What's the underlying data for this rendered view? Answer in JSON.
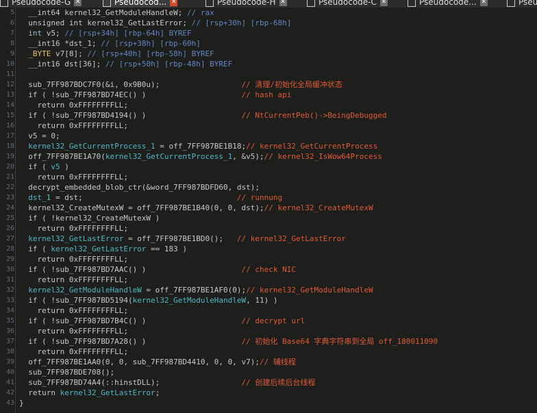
{
  "tabs": [
    {
      "label": "Pseudocode-G",
      "active": false
    },
    {
      "label": "Pseudocod...",
      "active": true
    },
    {
      "label": "Pseudocode-H",
      "active": false
    },
    {
      "label": "Pseudocode-C",
      "active": false
    },
    {
      "label": "Pseudocode...",
      "active": false
    },
    {
      "label": "Pseu",
      "active": false
    }
  ],
  "code": {
    "lines": [
      {
        "n": "5",
        "segs": [
          [
            "def",
            "  __int64 kernel32_GetModuleHandleW; "
          ],
          [
            "cm",
            "// rax"
          ]
        ]
      },
      {
        "n": "6",
        "segs": [
          [
            "def",
            "  unsigned int kernel32_GetLastError; "
          ],
          [
            "cm",
            "// [rsp+30h] [rbp-68h]"
          ]
        ]
      },
      {
        "n": "7",
        "segs": [
          [
            "type",
            "  int"
          ],
          [
            "def",
            " v5; "
          ],
          [
            "cm",
            "// [rsp+34h] [rbp-64h] BYREF"
          ]
        ]
      },
      {
        "n": "8",
        "segs": [
          [
            "def",
            "  __int16 *dst_1; "
          ],
          [
            "cm",
            "// [rsp+38h] [rbp-60h]"
          ]
        ]
      },
      {
        "n": "9",
        "segs": [
          [
            "var",
            "  _BYTE"
          ],
          [
            "def",
            " v7[8]; "
          ],
          [
            "cm",
            "// [rsp+40h] [rbp-58h] BYREF"
          ]
        ]
      },
      {
        "n": "10",
        "segs": [
          [
            "def",
            "  __int16 dst[36]; "
          ],
          [
            "cm",
            "// [rsp+50h] [rbp-48h] BYREF"
          ]
        ]
      },
      {
        "n": "11",
        "segs": [
          [
            "def",
            ""
          ]
        ]
      },
      {
        "n": "12",
        "segs": [
          [
            "def",
            "  sub_7FF987BDC7F0(&i, 0x9B0u);                  "
          ],
          [
            "cmz",
            "// 清理/初始化全局缓冲状态"
          ]
        ]
      },
      {
        "n": "13",
        "segs": [
          [
            "def",
            "  if ( !sub_7FF987BD74EC() )                     "
          ],
          [
            "cmz",
            "// hash api"
          ]
        ]
      },
      {
        "n": "14",
        "segs": [
          [
            "def",
            "    return 0xFFFFFFFFLL;"
          ]
        ]
      },
      {
        "n": "15",
        "segs": [
          [
            "def",
            "  if ( !sub_7FF987BD4194() )                     "
          ],
          [
            "cmz",
            "// NtCurrentPeb()->BeingDebugged"
          ]
        ]
      },
      {
        "n": "16",
        "segs": [
          [
            "def",
            "    return 0xFFFFFFFFLL;"
          ]
        ]
      },
      {
        "n": "17",
        "segs": [
          [
            "def",
            "  v5 = 0;"
          ]
        ]
      },
      {
        "n": "18",
        "segs": [
          [
            "gl",
            "  kernel32_GetCurrentProcess_1"
          ],
          [
            "def",
            " = off_7FF987BE1B18;"
          ],
          [
            "cmz",
            "// kernel32_GetCurrentProcess"
          ]
        ]
      },
      {
        "n": "19",
        "segs": [
          [
            "def",
            "  off_7FF987BE1A70("
          ],
          [
            "gl",
            "kernel32_GetCurrentProcess_1"
          ],
          [
            "def",
            ", &v5);"
          ],
          [
            "cmz",
            "// kernel32_IsWow64Process"
          ]
        ]
      },
      {
        "n": "20",
        "segs": [
          [
            "def",
            "  if ( "
          ],
          [
            "gl",
            "v5"
          ],
          [
            "def",
            " )"
          ]
        ]
      },
      {
        "n": "21",
        "segs": [
          [
            "def",
            "    return 0xFFFFFFFFLL;"
          ]
        ]
      },
      {
        "n": "22",
        "segs": [
          [
            "def",
            "  decrypt_embedded_blob_ctr(&word_7FF987BDFD60, "
          ],
          [
            "def",
            "dst"
          ],
          [
            "def",
            ");"
          ]
        ]
      },
      {
        "n": "23",
        "segs": [
          [
            "gl",
            "  dst_1"
          ],
          [
            "def",
            " = dst;                                  "
          ],
          [
            "cmz",
            "// runnung"
          ]
        ]
      },
      {
        "n": "24",
        "segs": [
          [
            "def",
            "  kernel32_CreateMutexW = off_7FF987BE1B40(0, 0, dst);"
          ],
          [
            "cmz",
            "// kernel32_CreateMutexW"
          ]
        ]
      },
      {
        "n": "25",
        "segs": [
          [
            "def",
            "  if ( !kernel32_CreateMutexW )"
          ]
        ]
      },
      {
        "n": "26",
        "segs": [
          [
            "def",
            "    return 0xFFFFFFFFLL;"
          ]
        ]
      },
      {
        "n": "27",
        "segs": [
          [
            "gl",
            "  kernel32_GetLastError"
          ],
          [
            "def",
            " = off_7FF987BE1BD0();   "
          ],
          [
            "cmz",
            "// kernel32_GetLastError"
          ]
        ]
      },
      {
        "n": "28",
        "segs": [
          [
            "def",
            "  if ( "
          ],
          [
            "gl",
            "kernel32_GetLastError"
          ],
          [
            "def",
            " == 183 )"
          ]
        ]
      },
      {
        "n": "29",
        "segs": [
          [
            "def",
            "    return 0xFFFFFFFFLL;"
          ]
        ]
      },
      {
        "n": "30",
        "segs": [
          [
            "def",
            "  if ( !sub_7FF987BD7AAC() )                     "
          ],
          [
            "cmz",
            "// check NIC"
          ]
        ]
      },
      {
        "n": "31",
        "segs": [
          [
            "def",
            "    return 0xFFFFFFFFLL;"
          ]
        ]
      },
      {
        "n": "32",
        "segs": [
          [
            "gl",
            "  kernel32_GetModuleHandleW"
          ],
          [
            "def",
            " = off_7FF987BE1AF0(0);"
          ],
          [
            "cmz",
            "// kernel32_GetModuleHandleW"
          ]
        ]
      },
      {
        "n": "33",
        "segs": [
          [
            "def",
            "  if ( !sub_7FF987BD5194("
          ],
          [
            "gl",
            "kernel32_GetModuleHandleW"
          ],
          [
            "def",
            ", 11) )"
          ]
        ]
      },
      {
        "n": "34",
        "segs": [
          [
            "def",
            "    return 0xFFFFFFFFLL;"
          ]
        ]
      },
      {
        "n": "35",
        "segs": [
          [
            "def",
            "  if ( !sub_7FF987BD7B4C() )                     "
          ],
          [
            "cmz",
            "// decrypt url"
          ]
        ]
      },
      {
        "n": "36",
        "segs": [
          [
            "def",
            "    return 0xFFFFFFFFLL;"
          ]
        ]
      },
      {
        "n": "37",
        "segs": [
          [
            "def",
            "  if ( !sub_7FF987BD7A28() )                     "
          ],
          [
            "cmz",
            "// 初始化 Base64 字典字符串到全局 off_180011090"
          ]
        ]
      },
      {
        "n": "38",
        "segs": [
          [
            "def",
            "    return 0xFFFFFFFFLL;"
          ]
        ]
      },
      {
        "n": "39",
        "segs": [
          [
            "def",
            "  off_7FF987BE1AA0(0, 0, sub_7FF987BD4410, 0, 0, v7);"
          ],
          [
            "cmz",
            "// 辅线程"
          ]
        ]
      },
      {
        "n": "40",
        "segs": [
          [
            "def",
            "  sub_7FF987BDE708();"
          ]
        ]
      },
      {
        "n": "41",
        "segs": [
          [
            "def",
            "  sub_7FF987BD74A4(::hinstDLL);                  "
          ],
          [
            "cmz",
            "// 创建后续后台线程"
          ]
        ]
      },
      {
        "n": "42",
        "segs": [
          [
            "def",
            "  return "
          ],
          [
            "gl",
            "kernel32_GetLastError"
          ],
          [
            "def",
            ";"
          ]
        ]
      },
      {
        "n": "43",
        "segs": [
          [
            "def",
            "}"
          ]
        ]
      }
    ]
  }
}
